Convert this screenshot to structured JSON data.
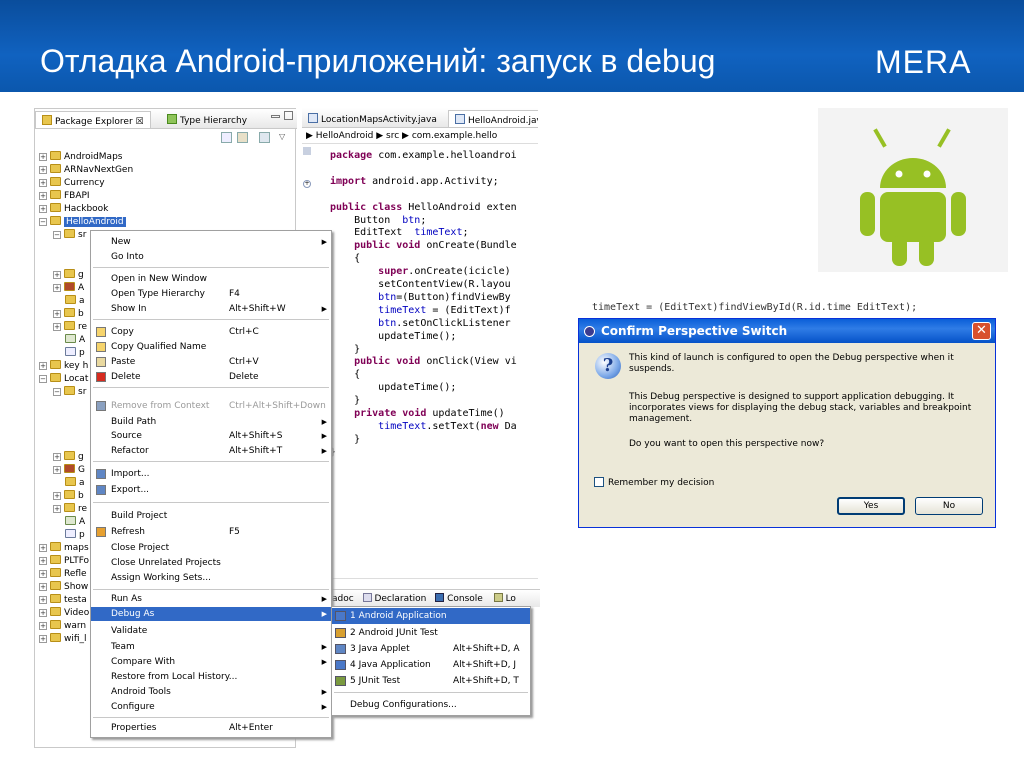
{
  "slide": {
    "title": "Отладка Android-приложений: запуск в debug",
    "logo": "MERA",
    "banner_color": "#0b57ad"
  },
  "package_explorer": {
    "tab_label": "Package Explorer",
    "tab_close": "☒",
    "tab2_label": "Type Hierarchy",
    "items": [
      {
        "label": "AndroidMaps"
      },
      {
        "label": "ARNavNextGen"
      },
      {
        "label": "Currency"
      },
      {
        "label": "FBAPI"
      },
      {
        "label": "Hackbook"
      },
      {
        "label": "HelloAndroid",
        "selected": true
      }
    ],
    "tail_items": [
      "maps",
      "PLTFo",
      "Refle",
      "Show",
      "testa",
      "Video",
      "warn",
      "wifi_l"
    ],
    "partial_items": [
      "sr",
      "g",
      "A",
      "a",
      "b",
      "re",
      "A",
      "p",
      "key h",
      "Locat",
      "sr",
      "g",
      "G",
      "a",
      "b",
      "re",
      "A",
      "p"
    ]
  },
  "context_menu": {
    "items": [
      {
        "label": "New",
        "shortcut": "",
        "arrow": true
      },
      {
        "label": "Go Into",
        "shortcut": ""
      },
      {
        "label": "Open in New Window",
        "shortcut": ""
      },
      {
        "label": "Open Type Hierarchy",
        "shortcut": "F4"
      },
      {
        "label": "Show In",
        "shortcut": "Alt+Shift+W",
        "arrow": true
      },
      {
        "label": "Copy",
        "shortcut": "Ctrl+C"
      },
      {
        "label": "Copy Qualified Name",
        "shortcut": ""
      },
      {
        "label": "Paste",
        "shortcut": "Ctrl+V"
      },
      {
        "label": "Delete",
        "shortcut": "Delete"
      },
      {
        "label": "Remove from Context",
        "shortcut": "Ctrl+Alt+Shift+Down",
        "disabled": true
      },
      {
        "label": "Build Path",
        "shortcut": "",
        "arrow": true
      },
      {
        "label": "Source",
        "shortcut": "Alt+Shift+S",
        "arrow": true
      },
      {
        "label": "Refactor",
        "shortcut": "Alt+Shift+T",
        "arrow": true
      },
      {
        "label": "Import...",
        "shortcut": ""
      },
      {
        "label": "Export...",
        "shortcut": ""
      },
      {
        "label": "Build Project",
        "shortcut": ""
      },
      {
        "label": "Refresh",
        "shortcut": "F5"
      },
      {
        "label": "Close Project",
        "shortcut": ""
      },
      {
        "label": "Close Unrelated Projects",
        "shortcut": ""
      },
      {
        "label": "Assign Working Sets...",
        "shortcut": ""
      },
      {
        "label": "Run As",
        "shortcut": "",
        "arrow": true
      },
      {
        "label": "Debug As",
        "shortcut": "",
        "arrow": true,
        "highlighted": true
      },
      {
        "label": "Validate",
        "shortcut": ""
      },
      {
        "label": "Team",
        "shortcut": "",
        "arrow": true
      },
      {
        "label": "Compare With",
        "shortcut": "",
        "arrow": true
      },
      {
        "label": "Restore from Local History...",
        "shortcut": ""
      },
      {
        "label": "Android Tools",
        "shortcut": "",
        "arrow": true
      },
      {
        "label": "Configure",
        "shortcut": "",
        "arrow": true
      },
      {
        "label": "Properties",
        "shortcut": "Alt+Enter"
      }
    ],
    "arrow_glyph": "▶"
  },
  "debug_submenu": {
    "items": [
      {
        "label": "1 Android Application",
        "shortcut": "",
        "highlighted": true
      },
      {
        "label": "2 Android JUnit Test",
        "shortcut": ""
      },
      {
        "label": "3 Java Applet",
        "shortcut": "Alt+Shift+D, A"
      },
      {
        "label": "4 Java Application",
        "shortcut": "Alt+Shift+D, J"
      },
      {
        "label": "5 JUnit Test",
        "shortcut": "Alt+Shift+D, T"
      },
      {
        "label": "Debug Configurations...",
        "shortcut": ""
      }
    ]
  },
  "editor": {
    "tabs": [
      "LocationMapsActivity.java",
      "HelloAndroid.java"
    ],
    "breadcrumb": "▶ HelloAndroid ▶ src ▶ com.example.hello",
    "code_lines": [
      "package com.example.helloandroi",
      "",
      "import android.app.Activity;",
      "",
      "public class HelloAndroid exten",
      "    Button  btn;",
      "    EditText  timeText;",
      "    public void onCreate(Bundle",
      "    {",
      "        super.onCreate(icicle)",
      "        setContentView(R.layou",
      "        btn=(Button)findViewBy",
      "        timeText = (EditText)f",
      "        btn.setOnClickListener",
      "        updateTime();",
      "    }",
      "    public void onClick(View vi",
      "    {",
      "        updateTime();",
      "    }",
      "    private void updateTime()",
      "        timeText.setText(new Da",
      "    }",
      "}"
    ],
    "bottom_tabs": [
      "adoc",
      "Declaration",
      "Console",
      "Lo"
    ]
  },
  "dialog": {
    "title": "Confirm Perspective Switch",
    "close_glyph": "✕",
    "icon_glyph": "?",
    "background_code": "timeText = (EditText)findViewById(R.id.time EditText);",
    "p1": "This kind of launch is configured to open the Debug perspective when it suspends.",
    "p2": "This Debug perspective is designed to support application debugging.  It incorporates views for displaying the debug stack, variables and breakpoint management.",
    "p3": "Do you want to open this perspective now?",
    "checkbox_label": "Remember my decision",
    "yes_label": "Yes",
    "no_label": "No"
  },
  "colors": {
    "selection": "#3169c6",
    "keyword": "#7f0055",
    "field": "#0000c0",
    "android_green": "#97c024"
  }
}
